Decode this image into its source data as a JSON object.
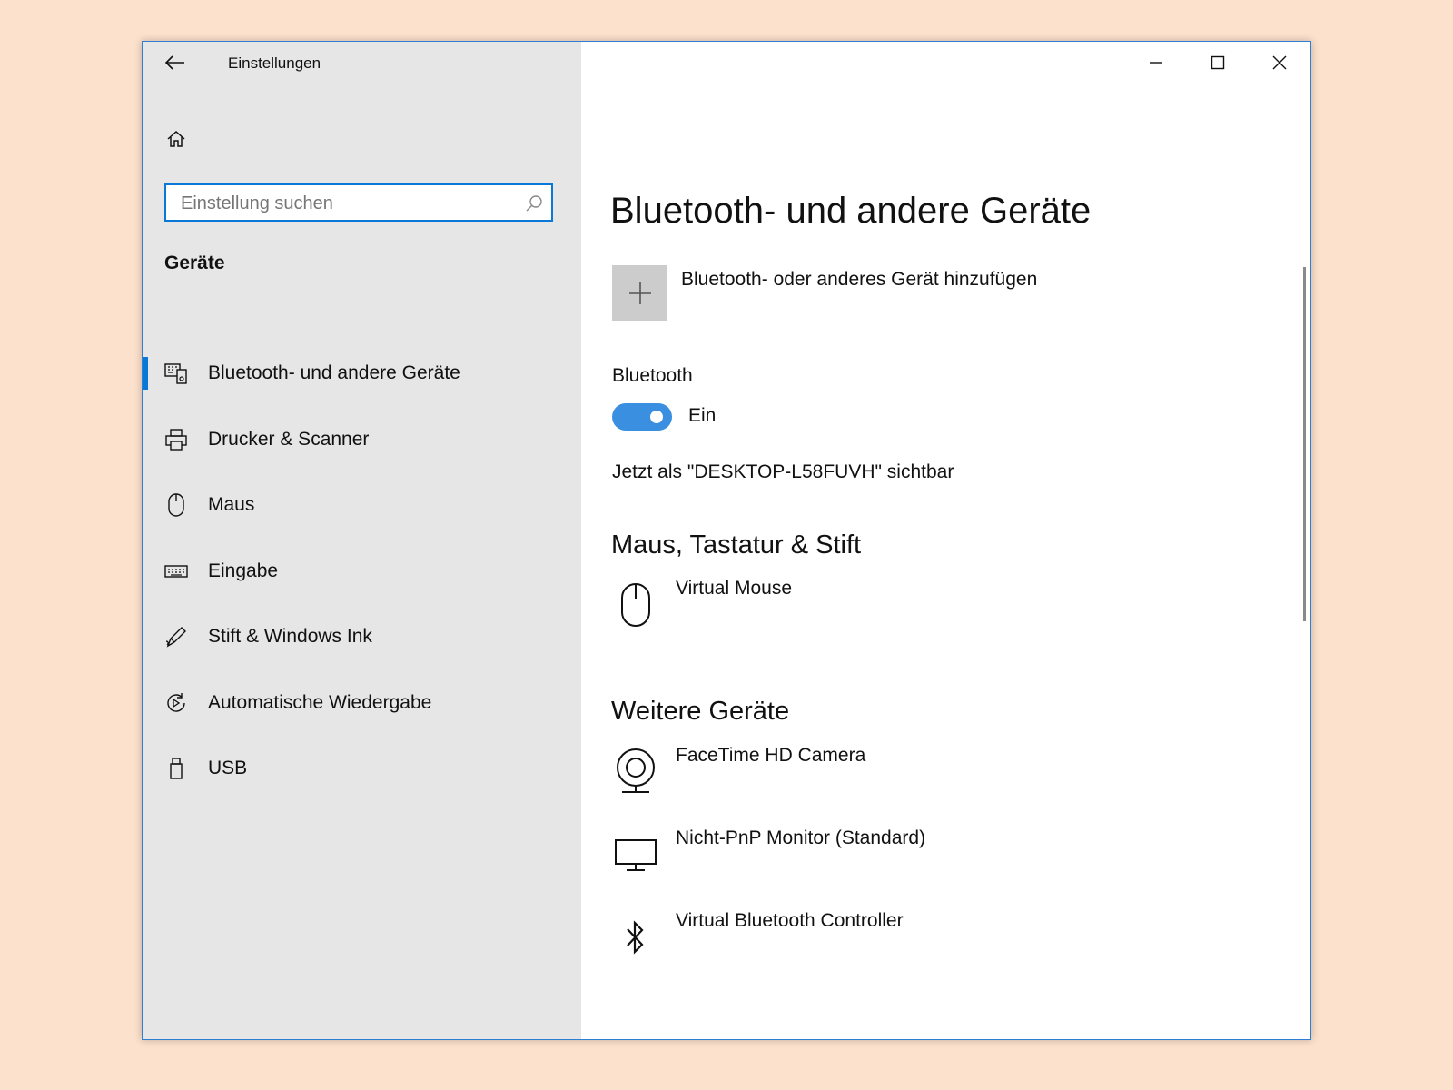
{
  "window": {
    "title": "Einstellungen",
    "controls": {
      "minimize": "minimize-icon",
      "maximize": "maximize-icon",
      "close": "close-icon"
    }
  },
  "sidebar": {
    "search_placeholder": "Einstellung suchen",
    "section_title": "Geräte",
    "items": [
      {
        "label": "Bluetooth- und andere Geräte",
        "icon": "bluetooth-devices-icon",
        "active": true
      },
      {
        "label": "Drucker & Scanner",
        "icon": "printer-icon"
      },
      {
        "label": "Maus",
        "icon": "mouse-icon"
      },
      {
        "label": "Eingabe",
        "icon": "keyboard-icon"
      },
      {
        "label": "Stift & Windows Ink",
        "icon": "pen-icon"
      },
      {
        "label": "Automatische Wiedergabe",
        "icon": "autoplay-icon"
      },
      {
        "label": "USB",
        "icon": "usb-icon"
      }
    ]
  },
  "main": {
    "title": "Bluetooth- und andere Geräte",
    "add_device_label": "Bluetooth- oder anderes Gerät hinzufügen",
    "bluetooth_label": "Bluetooth",
    "bluetooth_state": "Ein",
    "visible_text": "Jetzt als \"DESKTOP-L58FUVH\" sichtbar",
    "group_mouse": {
      "title": "Maus, Tastatur & Stift",
      "devices": [
        {
          "label": "Virtual Mouse",
          "icon": "mouse-icon"
        }
      ]
    },
    "group_other": {
      "title": "Weitere Geräte",
      "devices": [
        {
          "label": "FaceTime HD Camera",
          "icon": "webcam-icon"
        },
        {
          "label": "Nicht-PnP Monitor (Standard)",
          "icon": "monitor-icon"
        },
        {
          "label": "Virtual Bluetooth Controller",
          "icon": "bluetooth-icon"
        }
      ]
    }
  },
  "colors": {
    "accent": "#0a78d7",
    "toggle_on": "#3a8fe0",
    "sidebar_bg": "#e6e6e6",
    "page_bg": "#fce1cc"
  }
}
